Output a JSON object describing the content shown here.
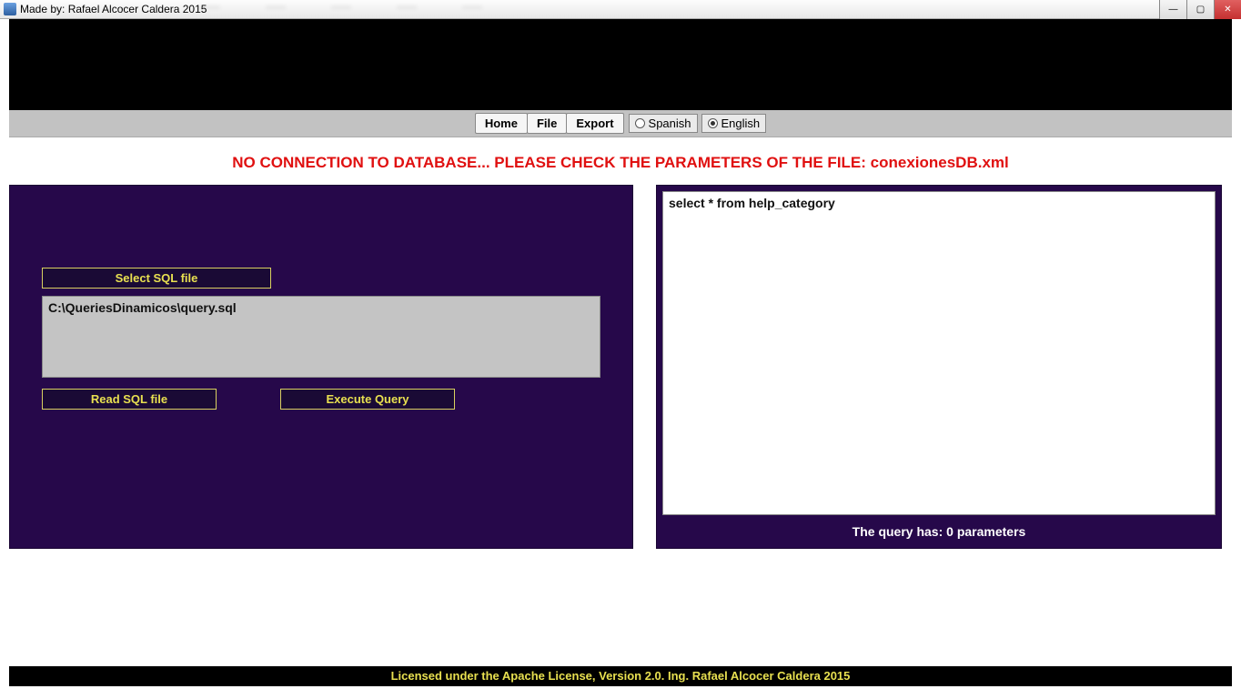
{
  "titlebar": {
    "text": "Made by: Rafael Alcocer Caldera 2015"
  },
  "menu": {
    "home": "Home",
    "file": "File",
    "export": "Export",
    "lang_spanish": "Spanish",
    "lang_english": "English"
  },
  "error": "NO CONNECTION TO DATABASE... PLEASE CHECK THE PARAMETERS OF THE FILE: conexionesDB.xml",
  "left": {
    "select_btn": "Select SQL file",
    "file_path": "C:\\QueriesDinamicos\\query.sql",
    "read_btn": "Read SQL file",
    "execute_btn": "Execute Query"
  },
  "right": {
    "query_text": "select * from help_category",
    "param_text": "The query has: 0 parameters"
  },
  "footer": "Licensed under the Apache License, Version 2.0. Ing. Rafael Alcocer Caldera 2015"
}
